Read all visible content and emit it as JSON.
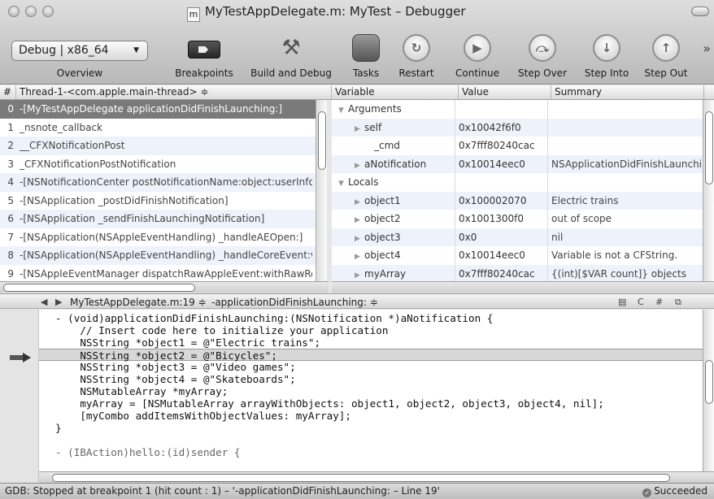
{
  "window": {
    "title": "MyTestAppDelegate.m: MyTest – Debugger",
    "file_icon": "m"
  },
  "toolbar": {
    "overview_value": "Debug | x86_64",
    "overview_label": "Overview",
    "buttons": [
      {
        "label": "Breakpoints",
        "icon": "breakpoint-icon"
      },
      {
        "label": "Build and Debug",
        "icon": "hammer-icon"
      },
      {
        "label": "Tasks",
        "icon": "stop-icon"
      },
      {
        "label": "Restart",
        "icon": "restart-icon"
      },
      {
        "label": "Continue",
        "icon": "continue-icon"
      },
      {
        "label": "Step Over",
        "icon": "step-over-icon"
      },
      {
        "label": "Step Into",
        "icon": "step-into-icon"
      },
      {
        "label": "Step Out",
        "icon": "step-out-icon"
      }
    ],
    "overflow": "»"
  },
  "threads": {
    "col_num": "#",
    "col_thread": "Thread-1-<com.apple.main-thread> ≑",
    "rows": [
      {
        "n": "0",
        "fn": "-[MyTestAppDelegate applicationDidFinishLaunching:]"
      },
      {
        "n": "1",
        "fn": "_nsnote_callback"
      },
      {
        "n": "2",
        "fn": "__CFXNotificationPost"
      },
      {
        "n": "3",
        "fn": "_CFXNotificationPostNotification"
      },
      {
        "n": "4",
        "fn": "-[NSNotificationCenter postNotificationName:object:userInfo:]"
      },
      {
        "n": "5",
        "fn": "-[NSApplication _postDidFinishNotification]"
      },
      {
        "n": "6",
        "fn": "-[NSApplication _sendFinishLaunchingNotification]"
      },
      {
        "n": "7",
        "fn": "-[NSApplication(NSAppleEventHandling) _handleAEOpen:]"
      },
      {
        "n": "8",
        "fn": "-[NSApplication(NSAppleEventHandling) _handleCoreEvent:withReplyEvent:]"
      },
      {
        "n": "9",
        "fn": "-[NSAppleEventManager dispatchRawAppleEvent:withRawReply:handlerRefCon:]"
      }
    ]
  },
  "variables": {
    "col_variable": "Variable",
    "col_value": "Value",
    "col_summary": "Summary",
    "rows": [
      {
        "name": "Arguments",
        "value": "",
        "summary": "",
        "indent": 0,
        "open": true
      },
      {
        "name": "self",
        "value": "0x10042f6f0",
        "summary": "",
        "indent": 1,
        "open": false
      },
      {
        "name": "_cmd",
        "value": "0x7fff80240cac",
        "summary": "",
        "indent": 2,
        "open": null
      },
      {
        "name": "aNotification",
        "value": "0x10014eec0",
        "summary": "NSApplicationDidFinishLaunching",
        "indent": 1,
        "open": false
      },
      {
        "name": "Locals",
        "value": "",
        "summary": "",
        "indent": 0,
        "open": true
      },
      {
        "name": "object1",
        "value": "0x100002070",
        "summary": "Electric trains",
        "indent": 1,
        "open": false
      },
      {
        "name": "object2",
        "value": "0x1001300f0",
        "summary": "out of scope",
        "indent": 1,
        "open": false
      },
      {
        "name": "object3",
        "value": "0x0",
        "summary": "nil",
        "indent": 1,
        "open": false
      },
      {
        "name": "object4",
        "value": "0x10014eec0",
        "summary": "Variable is not a CFString.",
        "indent": 1,
        "open": false
      },
      {
        "name": "myArray",
        "value": "0x7fff80240cac",
        "summary": "{(int)[$VAR count]} objects",
        "indent": 1,
        "open": false
      }
    ]
  },
  "editor": {
    "file_location": "MyTestAppDelegate.m:19 ≑",
    "symbol": "-applicationDidFinishLaunching: ≑",
    "lines": [
      "- (void)applicationDidFinishLaunching:(NSNotification *)aNotification {",
      "    // Insert code here to initialize your application",
      "    NSString *object1 = @\"Electric trains\";",
      "    NSString *object2 = @\"Bicycles\";",
      "    NSString *object3 = @\"Video games\";",
      "    NSString *object4 = @\"Skateboards\";",
      "    NSMutableArray *myArray;",
      "    myArray = [NSMutableArray arrayWithObjects: object1, object2, object3, object4, nil];",
      "    [myCombo addItemsWithObjectValues: myArray];",
      "}",
      "",
      "- (IBAction)hello:(id)sender {"
    ]
  },
  "status": {
    "message": "GDB: Stopped at breakpoint 1 (hit count : 1) – '-applicationDidFinishLaunching: – Line 19'",
    "result": "Succeeded"
  }
}
